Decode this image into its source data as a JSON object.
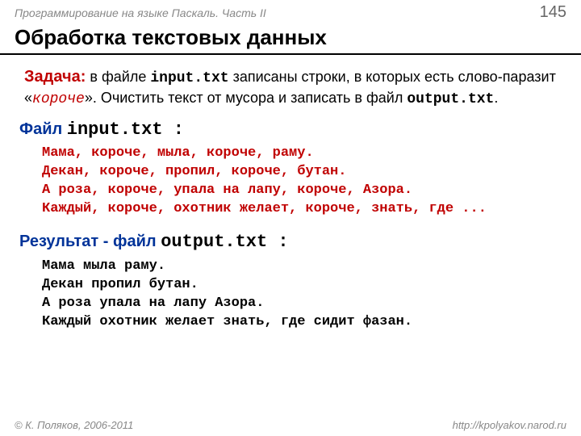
{
  "header": {
    "course": "Программирование на языке Паскаль. Часть II",
    "page": "145"
  },
  "title": "Обработка текстовых данных",
  "task": {
    "label": "Задача:",
    "pre1": " в файле ",
    "file1": "input.txt",
    "mid1": " записаны строки, в которых есть слово-паразит «",
    "word": "короче",
    "post1": "». Очистить текст от мусора и записать в файл ",
    "file2": "output.txt",
    "end": "."
  },
  "input": {
    "label": "Файл ",
    "filename": "input.txt",
    "colon": " :",
    "lines": [
      "Мама, короче, мыла, короче, раму.",
      "Декан, короче, пропил, короче, бутан.",
      "А роза, короче, упала на лапу, короче, Азора.",
      "Каждый, короче, охотник желает, короче, знать, где ..."
    ]
  },
  "output": {
    "label": "Результат - файл ",
    "filename": "output.txt",
    "colon": " :",
    "lines": [
      "Мама мыла раму.",
      "Декан пропил бутан.",
      "А роза упала на лапу Азора.",
      "Каждый охотник желает знать, где сидит фазан."
    ]
  },
  "footer": {
    "copyright": "© К. Поляков, 2006-2011",
    "url": "http://kpolyakov.narod.ru"
  }
}
